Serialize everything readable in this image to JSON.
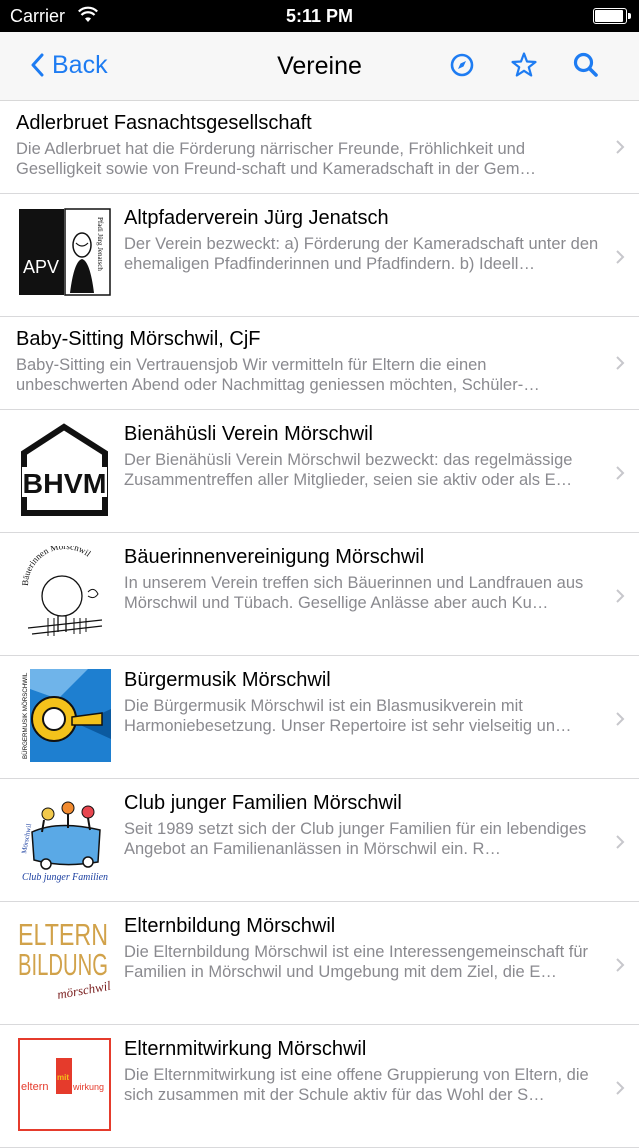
{
  "status_bar": {
    "carrier": "Carrier",
    "time": "5:11 PM",
    "battery_level": 1.0
  },
  "nav": {
    "back_label": "Back",
    "title": "Vereine",
    "icons": [
      "compass-icon",
      "star-icon",
      "search-icon"
    ],
    "accent_color": "#1e7cf2"
  },
  "items": [
    {
      "title": "Adlerbruet Fasnachtsgesellschaft",
      "description": "Die Adlerbruet hat die Förderung närrischer Freunde, Fröhlichkeit und Geselligkeit sowie von Freund-schaft und Kameradschaft in der Gem…"
    },
    {
      "title": "Altpfaderverein Jürg Jenatsch",
      "description": "Der Verein bezweckt: a) Förderung der Kameradschaft unter den ehemaligen Pfadfinderinnen und Pfadfindern. b) Ideell…",
      "logo": {
        "name": "apv-logo",
        "text": "APV",
        "side_text": "Pfadi Jürg Jenatsch"
      }
    },
    {
      "title": "Baby-Sitting Mörschwil, CjF",
      "description": "Baby-Sitting ein Vertrauensjob  Wir vermitteln für Eltern die einen unbeschwerten Abend oder Nachmittag geniessen möchten, Schüler-…"
    },
    {
      "title": "Bienähüsli Verein Mörschwil",
      "description": "Der Bienähüsli Verein Mörschwil bezweckt:  das regelmässige Zusammentreffen aller Mitglieder, seien sie aktiv oder als E…",
      "logo": {
        "name": "bhvm-logo",
        "text": "BHVM"
      }
    },
    {
      "title": "Bäuerinnenvereinigung Mörschwil",
      "description": "In unserem Verein treffen sich Bäuerinnen und Landfrauen aus Mörschwil und Tübach. Gesellige Anlässe aber auch Ku…",
      "logo": {
        "name": "baeuerinnen-logo",
        "text": "Bäuerinnen Mörschwil"
      }
    },
    {
      "title": "Bürgermusik Mörschwil",
      "description": "Die Bürgermusik Mörschwil ist ein Blasmusikverein mit Harmoniebesetzung. Unser Repertoire ist sehr vielseitig un…",
      "logo": {
        "name": "buergermusik-logo",
        "text": "BÜRGERMUSIK MÖRSCHWIL"
      }
    },
    {
      "title": "Club junger Familien Mörschwil",
      "description": "Seit 1989 setzt sich der Club junger Familien für ein lebendiges Angebot an Familienanlässen in Mörschwil ein. R…",
      "logo": {
        "name": "club-junger-familien-logo",
        "text": "Club junger Familien",
        "side_text": "Mörschwil"
      }
    },
    {
      "title": "Elternbildung Mörschwil",
      "description": "Die Elternbildung Mörschwil ist eine Interessengemeinschaft für Familien in Mörschwil und Umgebung mit dem Ziel, die E…",
      "logo": {
        "name": "elternbildung-logo",
        "text": "ELTERN",
        "text2": "BILDUNG",
        "text3": "mörschwil"
      }
    },
    {
      "title": "Elternmitwirkung Mörschwil",
      "description": "Die Elternmitwirkung ist eine offene Gruppierung von Eltern, die sich zusammen mit der Schule aktiv für das Wohl der S…",
      "logo": {
        "name": "elternmitwirkung-logo",
        "text": "eltern",
        "text2": "mit",
        "text3": "wirkung"
      }
    }
  ]
}
